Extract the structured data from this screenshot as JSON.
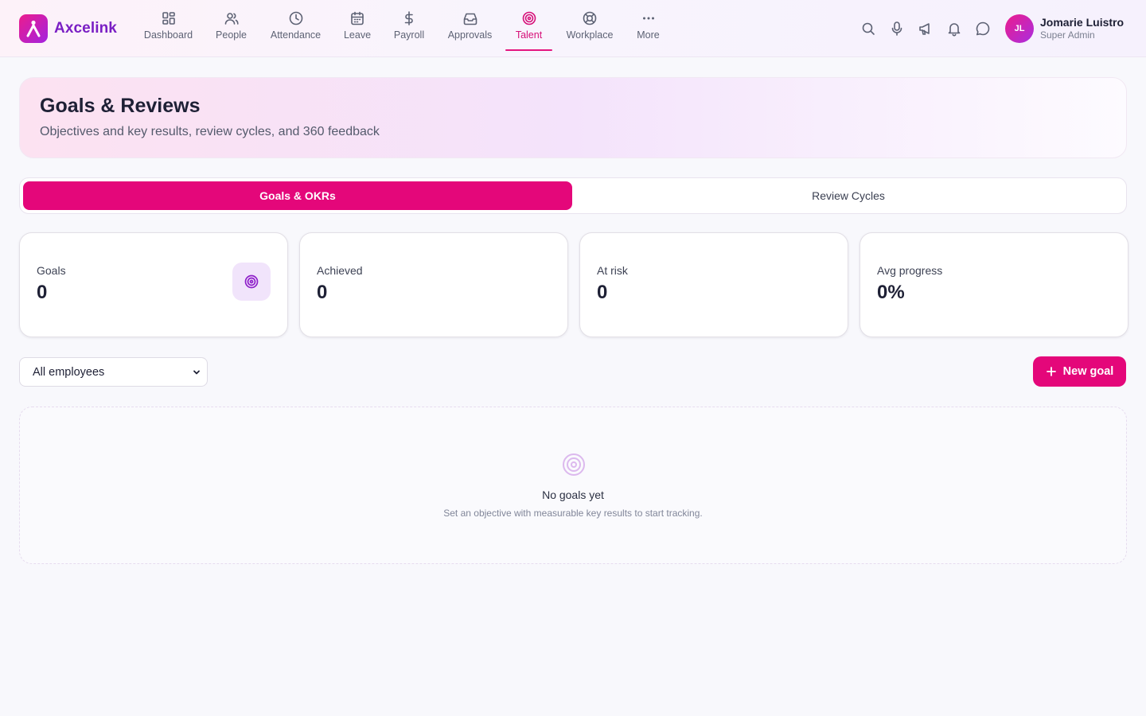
{
  "app": {
    "brand_name": "Axcelink",
    "accent_color": "#e4077a",
    "brand_gradient": [
      "#ec1c8c",
      "#a323e0"
    ]
  },
  "nav": {
    "items": [
      {
        "label": "Dashboard",
        "icon": "dashboard-grid-icon",
        "active": false
      },
      {
        "label": "People",
        "icon": "people-icon",
        "active": false
      },
      {
        "label": "Attendance",
        "icon": "clock-icon",
        "active": false
      },
      {
        "label": "Leave",
        "icon": "calendar-icon",
        "active": false
      },
      {
        "label": "Payroll",
        "icon": "dollar-icon",
        "active": false
      },
      {
        "label": "Approvals",
        "icon": "inbox-icon",
        "active": false
      },
      {
        "label": "Talent",
        "icon": "target-icon",
        "active": true
      },
      {
        "label": "Workplace",
        "icon": "lifebuoy-icon",
        "active": false
      },
      {
        "label": "More",
        "icon": "more-dots-icon",
        "active": false
      }
    ]
  },
  "toolbar": {
    "icons": [
      "search-icon",
      "microphone-icon",
      "megaphone-icon",
      "bell-icon",
      "chat-icon"
    ]
  },
  "user": {
    "initials": "JL",
    "name": "Jomarie Luistro",
    "role": "Super Admin"
  },
  "hero": {
    "title": "Goals & Reviews",
    "subtitle": "Objectives and key results, review cycles, and 360 feedback"
  },
  "tabs": [
    {
      "label": "Goals & OKRs",
      "active": true
    },
    {
      "label": "Review Cycles",
      "active": false
    }
  ],
  "stats": [
    {
      "label": "Goals",
      "value": "0",
      "icon": "target-icon"
    },
    {
      "label": "Achieved",
      "value": "0"
    },
    {
      "label": "At risk",
      "value": "0"
    },
    {
      "label": "Avg progress",
      "value": "0%"
    }
  ],
  "filter": {
    "selected": "All employees"
  },
  "actions": {
    "new_goal_label": "New goal"
  },
  "empty_state": {
    "title": "No goals yet",
    "subtitle": "Set an objective with measurable key results to start tracking."
  }
}
